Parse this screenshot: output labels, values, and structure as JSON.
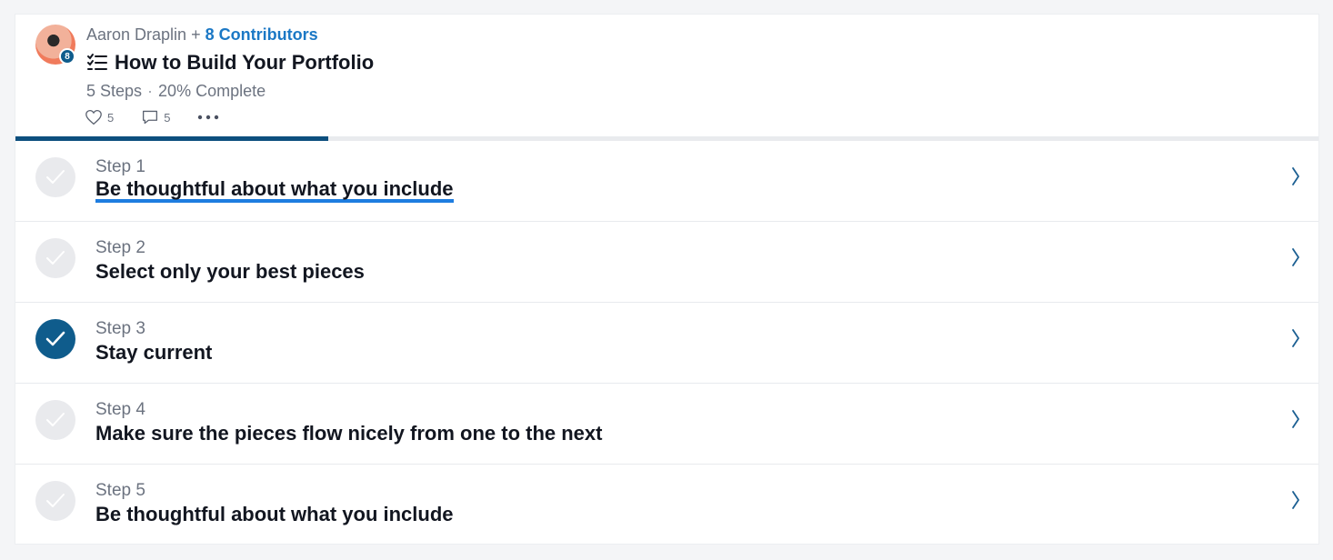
{
  "header": {
    "author": "Aaron Draplin",
    "plus": "+",
    "contributors_label": "8 Contributors",
    "avatar_badge": "8",
    "title": "How to Build Your Portfolio",
    "steps_count": "5 Steps",
    "separator": "·",
    "complete_label": "20% Complete",
    "likes": "5",
    "comments": "5",
    "more_icon": "ellipsis-icon"
  },
  "progress": {
    "fraction": 0.24
  },
  "colors": {
    "accent": "#0f5c8c",
    "link": "#1b78c5",
    "underline": "#1e7de0"
  },
  "steps": [
    {
      "number": "Step 1",
      "title": "Be thoughtful about what you include",
      "done": false,
      "active": true
    },
    {
      "number": "Step 2",
      "title": "Select only your best pieces",
      "done": false,
      "active": false
    },
    {
      "number": "Step 3",
      "title": "Stay current",
      "done": true,
      "active": false
    },
    {
      "number": "Step 4",
      "title": "Make sure the pieces flow nicely from one to the next",
      "done": false,
      "active": false
    },
    {
      "number": "Step 5",
      "title": "Be thoughtful about what you include",
      "done": false,
      "active": false
    }
  ]
}
